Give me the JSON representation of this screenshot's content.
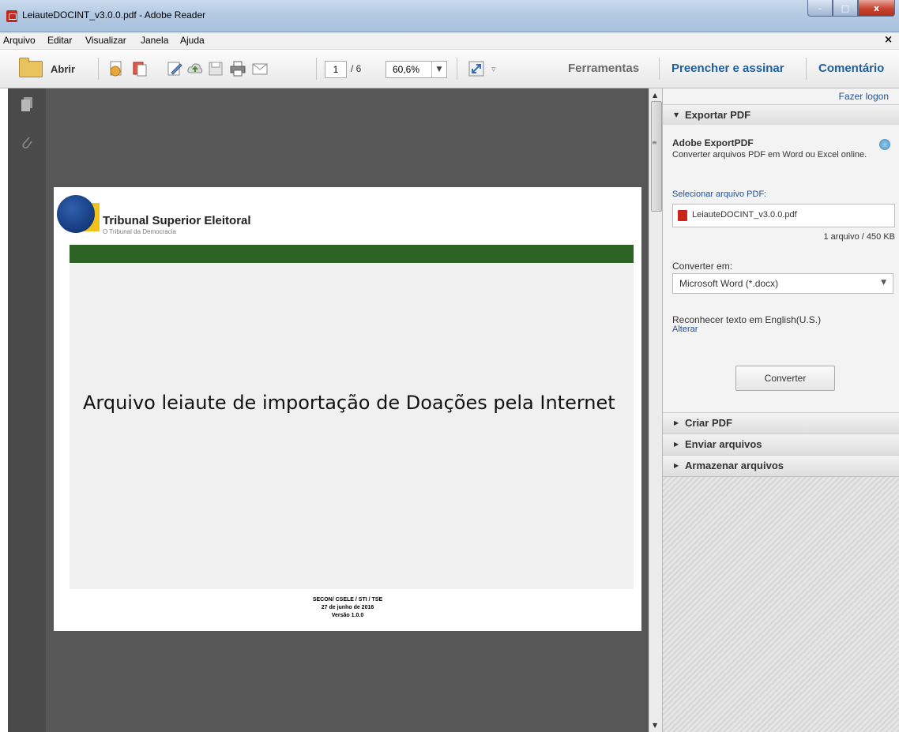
{
  "window": {
    "title": "LeiauteDOCINT_v3.0.0.pdf - Adobe Reader",
    "min_glyph": "–",
    "max_glyph": "□",
    "close_glyph": "x"
  },
  "menu": {
    "items": [
      "Arquivo",
      "Editar",
      "Visualizar",
      "Janela",
      "Ajuda"
    ],
    "close_glyph": "×"
  },
  "toolbar": {
    "open_label": "Abrir",
    "page_current": "1",
    "page_total": "/ 6",
    "zoom": "60,6%",
    "links": [
      "Ferramentas",
      "Preencher e assinar",
      "Comentário"
    ]
  },
  "document": {
    "org_name": "Tribunal Superior Eleitoral",
    "org_tagline": "O Tribunal da Democracia",
    "title": "Arquivo leiaute de importação de Doações pela Internet",
    "footer": [
      "SECON/ CSELE / STI / TSE",
      "27 de junho de 2016",
      "Versão 1.0.0"
    ]
  },
  "panel": {
    "logon": "Fazer logon",
    "export_title": "Exportar PDF",
    "service_title": "Adobe ExportPDF",
    "service_desc": "Converter arquivos PDF em Word ou Excel online.",
    "select_label": "Selecionar arquivo PDF:",
    "file_name": "LeiauteDOCINT_v3.0.0.pdf",
    "file_count": "1 arquivo / 450 KB",
    "convert_label": "Converter em:",
    "convert_value": "Microsoft Word (*.docx)",
    "ocr_text": "Reconhecer texto em English(U.S.)",
    "ocr_link": "Alterar",
    "convert_button": "Converter",
    "sections": [
      "Criar PDF",
      "Enviar arquivos",
      "Armazenar arquivos"
    ]
  },
  "colors": {
    "doc_bg": "#575757",
    "green_bar": "#2e6326",
    "link": "#1f5e9e"
  }
}
